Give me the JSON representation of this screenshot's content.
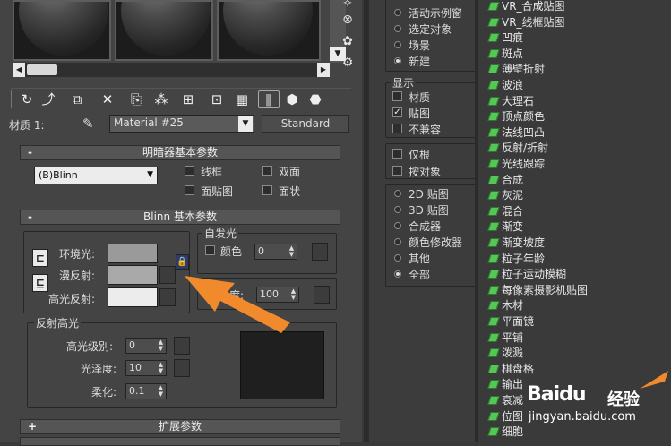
{
  "slots": {
    "count": 3
  },
  "material": {
    "label": "材质 1:",
    "name": "Material #25",
    "type_button": "Standard"
  },
  "shader_rollout": {
    "title": "明暗器基本参数",
    "collapse": "-",
    "shader": "(B)Blinn",
    "wire": "线框",
    "two_sided": "双面",
    "face_map": "面贴图",
    "faceted": "面状"
  },
  "blinn_rollout": {
    "title": "Blinn 基本参数",
    "collapse": "-",
    "ambient": "环境光:",
    "diffuse": "漫反射:",
    "specular": "高光反射:",
    "ambient_color": "#9a9a9a",
    "diffuse_color": "#a9a9a9",
    "specular_color": "#ececec",
    "self_illum_title": "自发光",
    "self_illum_color_label": "颜色",
    "self_illum_value": "0",
    "opacity_partial": "度:",
    "opacity_value": "100"
  },
  "specular_group": {
    "title": "反射高光",
    "level_label": "高光级别:",
    "level_value": "0",
    "gloss_label": "光泽度:",
    "gloss_value": "10",
    "soften_label": "柔化:",
    "soften_value": "0.1"
  },
  "extended_rollout": {
    "title": "扩展参数",
    "collapse": "+"
  },
  "browse_from": {
    "items": [
      {
        "label": "活动示例窗",
        "selected": false
      },
      {
        "label": "选定对象",
        "selected": false
      },
      {
        "label": "场景",
        "selected": false
      },
      {
        "label": "新建",
        "selected": true
      }
    ]
  },
  "show": {
    "title": "显示",
    "items": [
      {
        "label": "材质",
        "checked": false
      },
      {
        "label": "贴图",
        "checked": true
      },
      {
        "label": "不兼容",
        "checked": false
      }
    ]
  },
  "filter": {
    "items": [
      {
        "label": "仅根",
        "checked": false
      },
      {
        "label": "按对象",
        "checked": false
      }
    ]
  },
  "categories": {
    "items": [
      {
        "label": "2D 贴图",
        "selected": false
      },
      {
        "label": "3D 贴图",
        "selected": false
      },
      {
        "label": "合成器",
        "selected": false
      },
      {
        "label": "颜色修改器",
        "selected": false
      },
      {
        "label": "其他",
        "selected": false
      },
      {
        "label": "全部",
        "selected": true
      }
    ]
  },
  "map_list": [
    "VR_合成贴图",
    "VR_线框贴图",
    "凹痕",
    "斑点",
    "薄壁折射",
    "波浪",
    "大理石",
    "顶点颜色",
    "法线凹凸",
    "反射/折射",
    "光线跟踪",
    "合成",
    "灰泥",
    "混合",
    "渐变",
    "渐变坡度",
    "粒子年龄",
    "粒子运动模糊",
    "每像素摄影机贴图",
    "木材",
    "平面镜",
    "平铺",
    "泼溅",
    "棋盘格",
    "输出",
    "衰减",
    "位图",
    "细胞"
  ],
  "watermark": {
    "brand": "Baidu",
    "brand_cn": "经验",
    "url": "jingyan.baidu.com"
  },
  "colors": {
    "arrow": "#f08a2c",
    "map_icon": "#56c656"
  }
}
